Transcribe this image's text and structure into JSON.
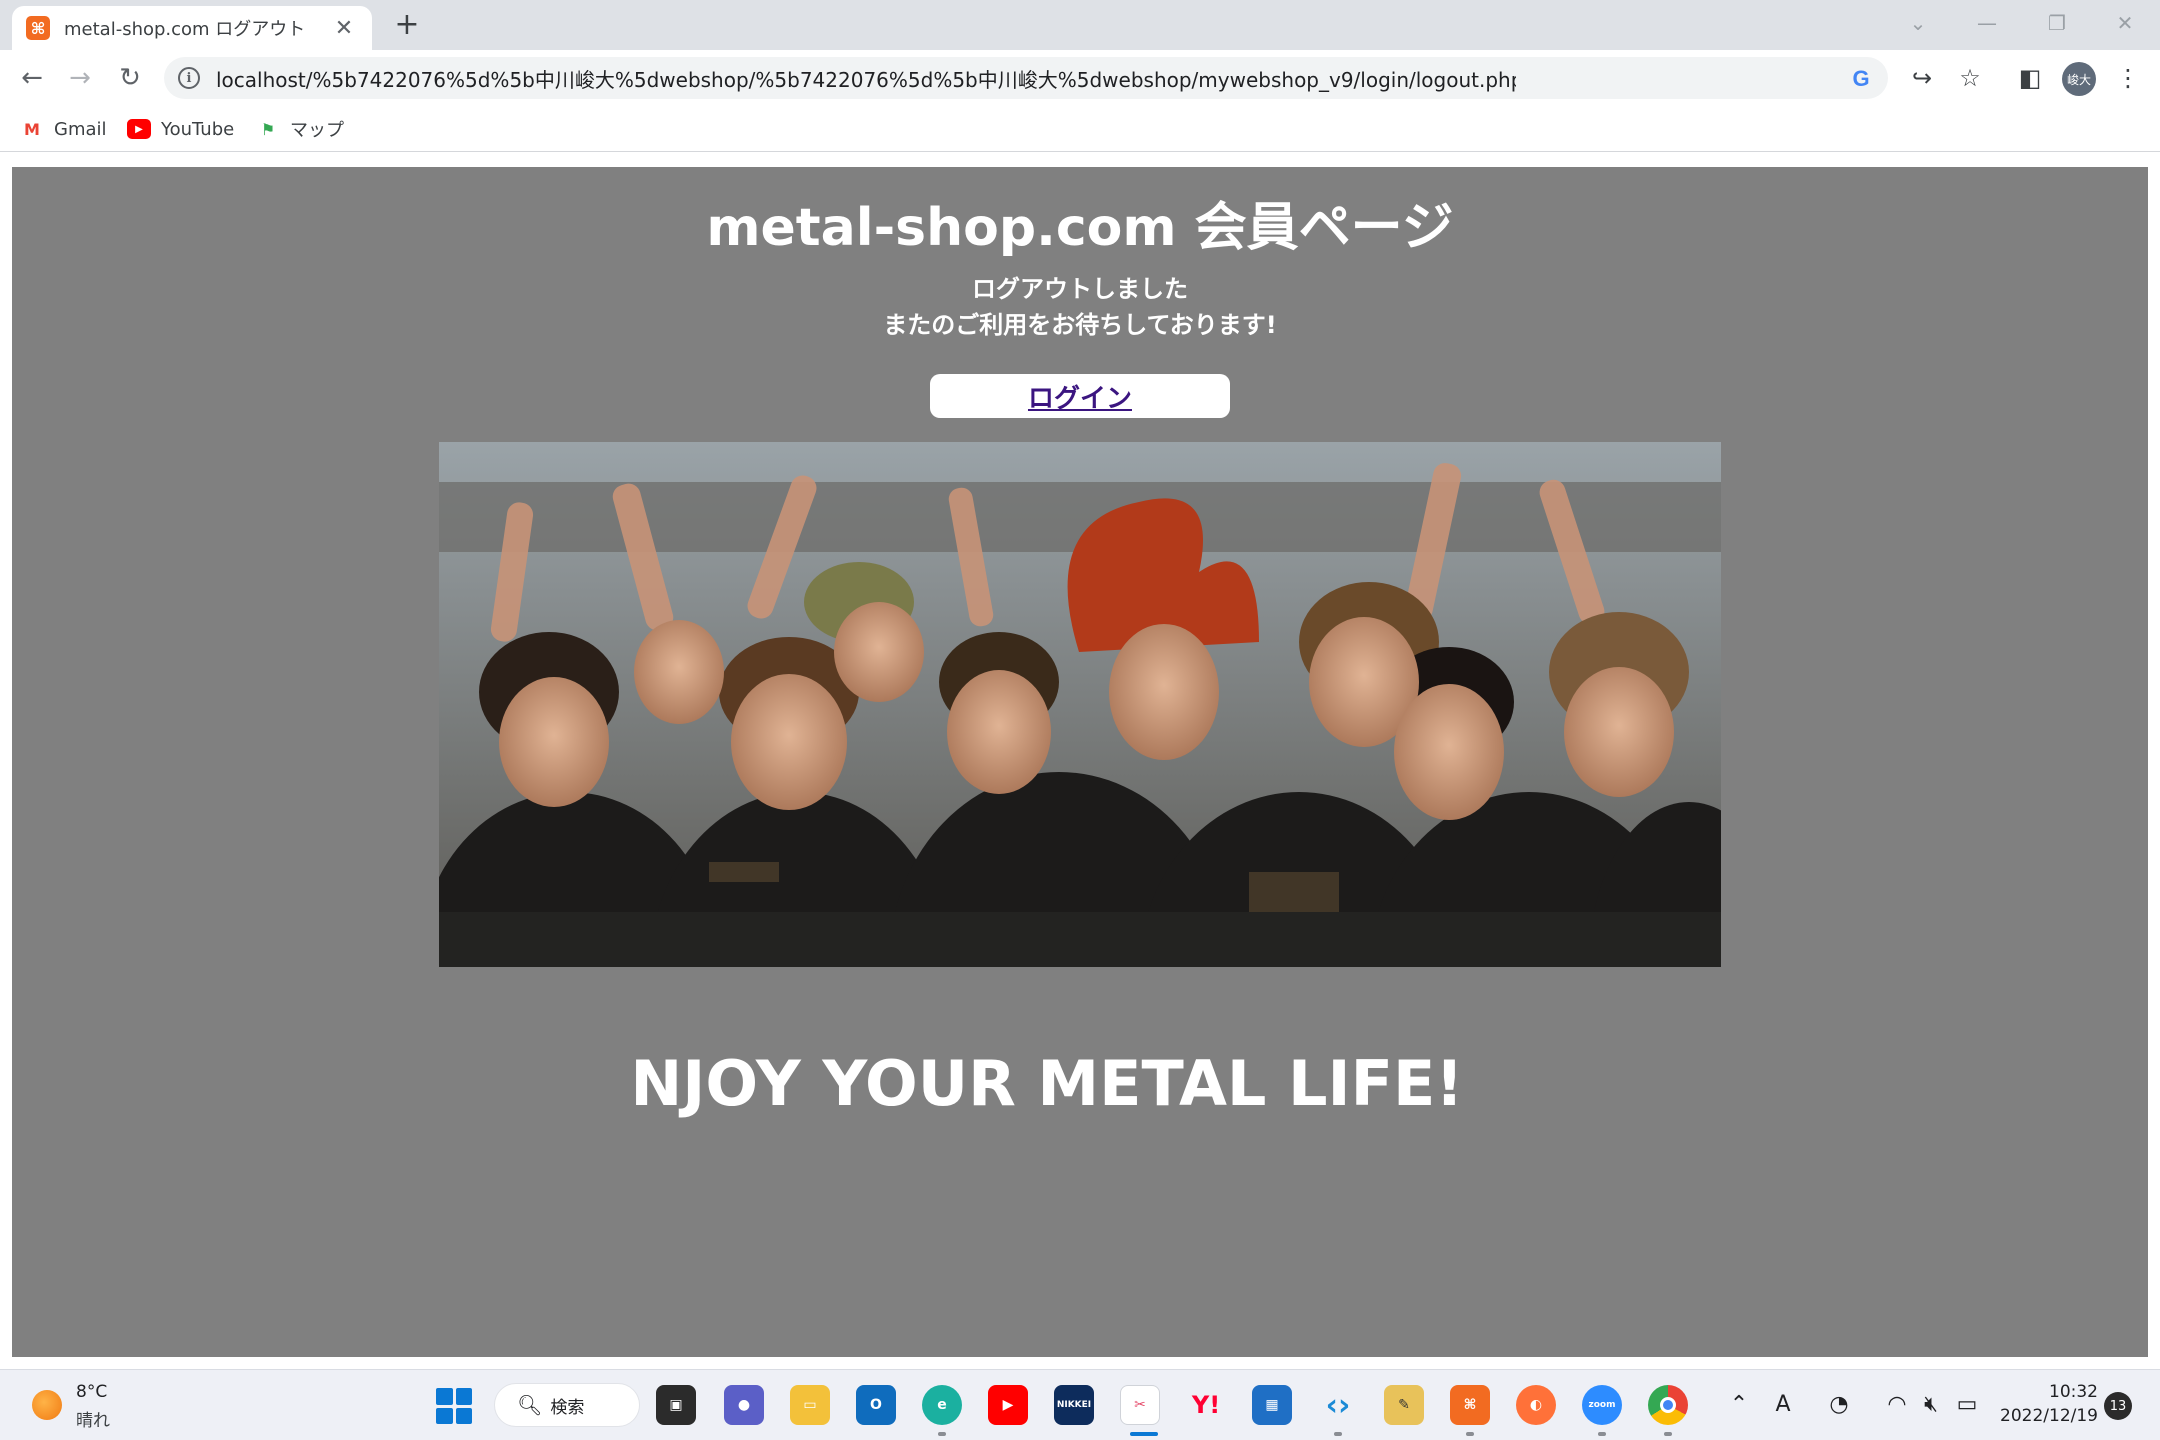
{
  "browser": {
    "tab_title": "metal-shop.com ログアウト",
    "tab_favicon": "xampp-icon",
    "url": "localhost/%5b7422076%5d%5b中川峻大%5dwebshop/%5b7422076%5d%5b中川峻大%5dwebshop/mywebshop_v9/login/logout.php",
    "profile_initials": "峻大",
    "bookmarks": [
      {
        "label": "Gmail",
        "icon": "gmail-icon"
      },
      {
        "label": "YouTube",
        "icon": "youtube-icon"
      },
      {
        "label": "マップ",
        "icon": "maps-icon"
      }
    ]
  },
  "page": {
    "title": "metal-shop.com 会員ページ",
    "message_line1": "ログアウトしました",
    "message_line2": "またのご利用をお待ちしております!",
    "login_link": "ログイン",
    "slogan": "NJOY YOUR METAL LIFE!",
    "background_color": "#808080"
  },
  "taskbar": {
    "weather_temp": "8°C",
    "weather_condition": "晴れ",
    "search_label": "検索",
    "clock_time": "10:32",
    "clock_date": "2022/12/19",
    "notification_count": "13",
    "tray_ime": "A"
  }
}
